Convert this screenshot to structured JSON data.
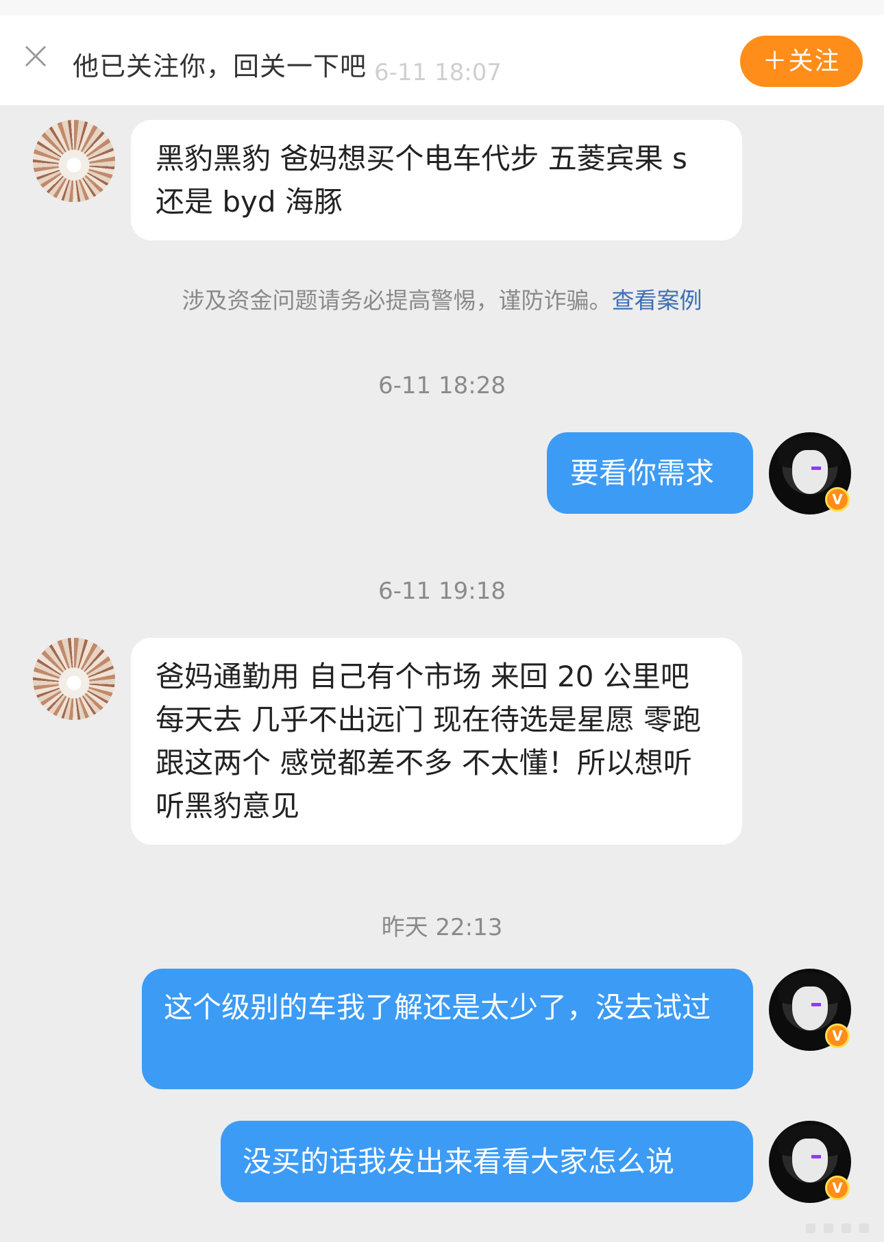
{
  "banner": {
    "text": "他已关注你，回关一下吧",
    "faded_time": "6-11 18:07",
    "follow_label": "＋关注"
  },
  "messages": [
    {
      "side": "in",
      "text": "黑豹黑豹 爸妈想买个电车代步 五菱宾果 s 还是 byd 海豚"
    },
    {
      "side": "out",
      "text": "要看你需求"
    },
    {
      "side": "in",
      "text": "爸妈通勤用  自己有个市场 来回 20 公里吧 每天去 几乎不出远门 现在待选是星愿 零跑 跟这两个 感觉都差不多 不太懂！所以想听听黑豹意见"
    },
    {
      "side": "out",
      "text": "这个级别的车我了解还是太少了，没去试过"
    },
    {
      "side": "out",
      "text": "没买的话我发出来看看大家怎么说"
    }
  ],
  "warning": {
    "text": "涉及资金问题请务必提高警惕，谨防诈骗。",
    "link": "查看案例"
  },
  "timestamps": [
    "6-11 18:28",
    "6-11 19:18",
    "昨天 22:13"
  ],
  "badge_letter": "V",
  "colors": {
    "accent": "#ff8d1a",
    "bubble_out": "#3c9bf5",
    "bubble_in": "#ffffff",
    "background": "#ededed",
    "link": "#3d6fb5"
  },
  "icons": [
    "close-icon",
    "verified-badge-icon"
  ]
}
